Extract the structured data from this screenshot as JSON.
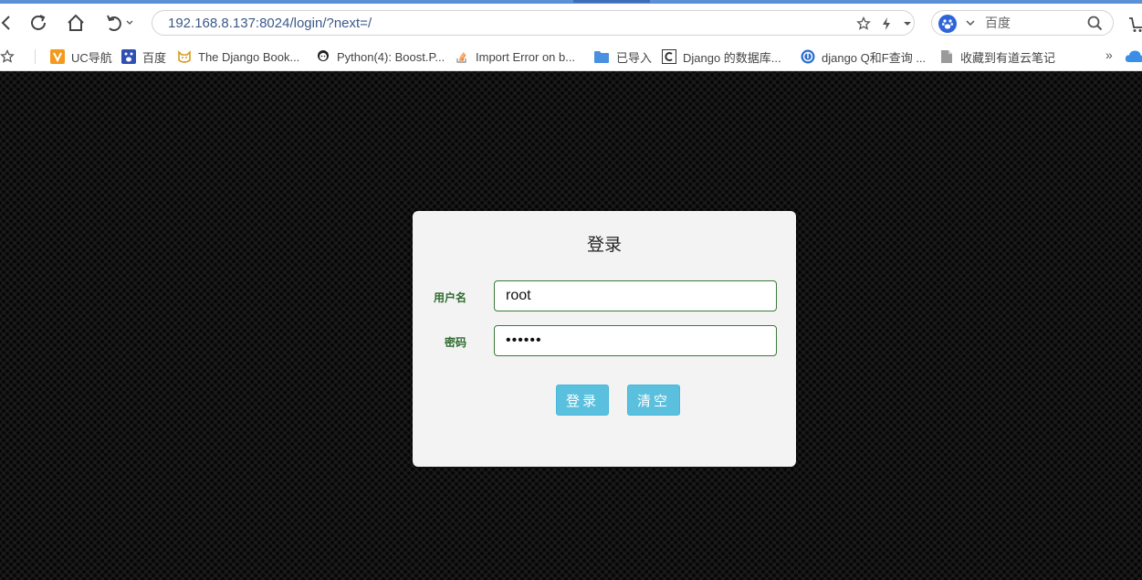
{
  "browser": {
    "address_url": "192.168.8.137:8024/login/?next=/",
    "search_placeholder": "百度",
    "bookmarks": [
      {
        "label": "UC导航"
      },
      {
        "label": "百度"
      },
      {
        "label": "The Django Book..."
      },
      {
        "label": "Python(4): Boost.P..."
      },
      {
        "label": "Import Error on b..."
      },
      {
        "label": "已导入"
      },
      {
        "label": "Django 的数据库..."
      },
      {
        "label": "django Q和F查询 ..."
      },
      {
        "label": "收藏到有道云笔记"
      }
    ],
    "overflow_label": "»"
  },
  "login": {
    "title": "登录",
    "username_label": "用户名",
    "username_value": "root",
    "password_label": "密码",
    "password_value": "••••••",
    "submit_label": "登录",
    "clear_label": "清空"
  },
  "colors": {
    "accent": "#5b8fd6",
    "button": "#5bc0de",
    "label_green": "#2e6b2e",
    "input_border": "#3a7a3a",
    "page_background": "#1c1c1c"
  }
}
